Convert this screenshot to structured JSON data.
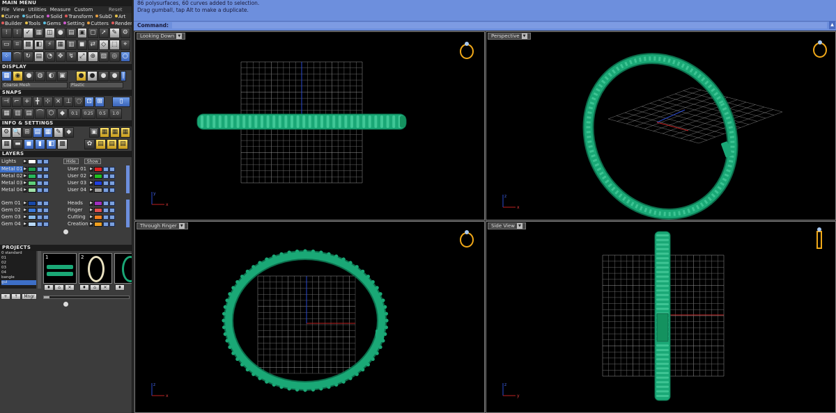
{
  "main_menu": {
    "title": "MAIN MENU",
    "menus": [
      "File",
      "View",
      "Utilities",
      "Measure",
      "Custom"
    ],
    "tabs_row1": [
      {
        "label": "Curve",
        "color": "#e6c24a"
      },
      {
        "label": "Surface",
        "color": "#5bc0e0"
      },
      {
        "label": "Solid",
        "color": "#d05ad0"
      },
      {
        "label": "Transform",
        "color": "#e05a5a"
      },
      {
        "label": "SubD",
        "color": "#e8a040"
      },
      {
        "label": "Art",
        "color": "#e6c24a"
      }
    ],
    "reset_label": "Reset",
    "tabs_row2": [
      {
        "label": "Builder",
        "color": "#e05a5a"
      },
      {
        "label": "Tools",
        "color": "#e6c24a"
      },
      {
        "label": "Gems",
        "color": "#5bc0e0"
      },
      {
        "label": "Setting",
        "color": "#d05ad0"
      },
      {
        "label": "Cutters",
        "color": "#e8a040"
      },
      {
        "label": "Render",
        "color": "#e05a5a"
      }
    ]
  },
  "display": {
    "title": "DISPLAY",
    "mesh_option": "Coarse Mesh",
    "material_option": "Plastic"
  },
  "snaps": {
    "title": "SNAPS",
    "values": [
      "0.1",
      "0.25",
      "0.5",
      "1.0"
    ]
  },
  "info_settings": {
    "title": "INFO & SETTINGS"
  },
  "layers": {
    "title": "LAYERS",
    "lights_label": "Lights",
    "hide_label": "Hide",
    "show_label": "Show",
    "left_group1": [
      {
        "name": "Metal 01",
        "color": "#1f9a4a",
        "selected": true
      },
      {
        "name": "Metal 02",
        "color": "#28b85a",
        "selected": false
      },
      {
        "name": "Metal 03",
        "color": "#5fd07a",
        "selected": false
      },
      {
        "name": "Metal 04",
        "color": "#9fe0a8",
        "selected": false
      }
    ],
    "right_group1": [
      {
        "name": "User 01",
        "color": "#e02020"
      },
      {
        "name": "User 02",
        "color": "#20c020"
      },
      {
        "name": "User 03",
        "color": "#2040e0"
      },
      {
        "name": "User 04",
        "color": "#a0a0a0"
      }
    ],
    "left_group2": [
      {
        "name": "Gem 01",
        "color": "#1848a8"
      },
      {
        "name": "Gem 02",
        "color": "#3a78d8"
      },
      {
        "name": "Gem 03",
        "color": "#88b8e8"
      },
      {
        "name": "Gem 04",
        "color": "#b8d8f8"
      }
    ],
    "right_group2": [
      {
        "name": "Heads",
        "color": "#a030c0"
      },
      {
        "name": "Finger",
        "color": "#e05050"
      },
      {
        "name": "Cutting",
        "color": "#f08020"
      },
      {
        "name": "Creation",
        "color": "#f0a020"
      }
    ]
  },
  "projects": {
    "title": "PROJECTS",
    "items": [
      "0 standard",
      "01",
      "02",
      "03",
      "04",
      "bangle",
      "gul"
    ],
    "thumbnails": [
      "1",
      "2"
    ],
    "buttons": [
      "+",
      "↑",
      "Mngr"
    ]
  },
  "command": {
    "line1": "86 polysurfaces, 60 curves added to selection.",
    "line2": "Drag gumball, tap Alt to make a duplicate.",
    "prompt_label": "Command:",
    "value": ""
  },
  "viewports": [
    {
      "label": "Looking Down",
      "axes": [
        "y",
        "x"
      ]
    },
    {
      "label": "Perspective",
      "axes": [
        "z",
        "y",
        "x"
      ]
    },
    {
      "label": "Through Finger",
      "axes": [
        "z",
        "x"
      ]
    },
    {
      "label": "Side View",
      "axes": [
        "z",
        "y"
      ]
    }
  ],
  "colors": {
    "ring_green": "#1aa876",
    "command_bg": "#6d8fdd",
    "grid": "#6a6a6a",
    "gumball_blue": "#2a4ad0",
    "gumball_red": "#c02020"
  }
}
